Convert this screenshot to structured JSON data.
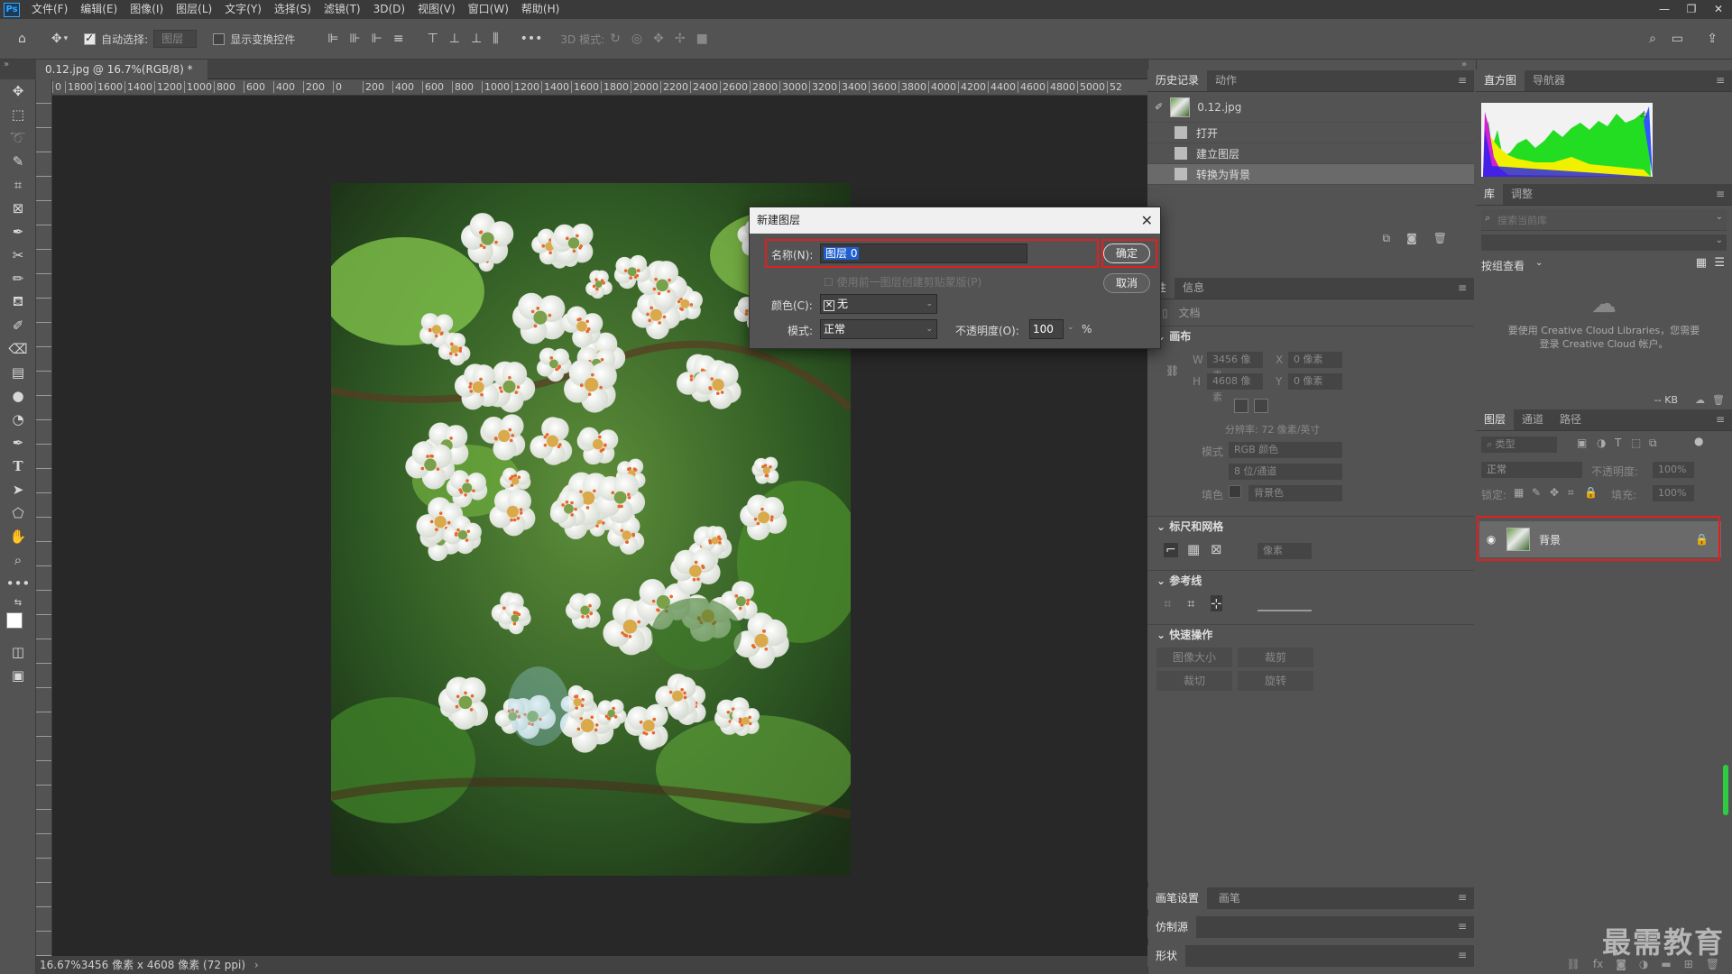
{
  "app": {
    "logo": "Ps"
  },
  "menu": [
    "文件(F)",
    "编辑(E)",
    "图像(I)",
    "图层(L)",
    "文字(Y)",
    "选择(S)",
    "滤镜(T)",
    "3D(D)",
    "视图(V)",
    "窗口(W)",
    "帮助(H)"
  ],
  "window_controls": [
    "—",
    "❐",
    "✕"
  ],
  "options_bar": {
    "auto_select_label": "自动选择:",
    "auto_select_target": "图层",
    "show_transform_label": "显示变换控件",
    "mode_3d_label": "3D 模式:",
    "more": "•••"
  },
  "document": {
    "tab_title": "0.12.jpg @ 16.7%(RGB/8) *",
    "tab_close": "×",
    "status": "16.67%3456 像素 x 4608 像素 (72 ppi)",
    "ruler_labels": [
      "0",
      "1800",
      "1600",
      "1400",
      "1200",
      "1000",
      "800",
      "600",
      "400",
      "200",
      "0",
      "200",
      "400",
      "600",
      "800",
      "1000",
      "1200",
      "1400",
      "1600",
      "1800",
      "2000",
      "2200",
      "2400",
      "2600",
      "2800",
      "3000",
      "3200",
      "3400",
      "3600",
      "3800",
      "4000",
      "4200",
      "4400",
      "4600",
      "4800",
      "5000",
      "52"
    ]
  },
  "history_panel": {
    "tabs": [
      "历史记录",
      "动作"
    ],
    "snapshot": "0.12.jpg",
    "items": [
      "打开",
      "建立图层",
      "转换为背景"
    ]
  },
  "properties_panel": {
    "tabs": [
      "性",
      "信息"
    ],
    "doc_label": "文档",
    "canvas_section": "画布",
    "w_label": "W",
    "w_value": "3456 像素",
    "h_label": "H",
    "h_value": "4608 像素",
    "x_label": "X",
    "x_value": "0 像素",
    "y_label": "Y",
    "y_value": "0 像素",
    "resolution": "分辨率: 72 像素/英寸",
    "mode_label": "模式",
    "mode_value": "RGB 颜色",
    "depth_value": "8 位/通道",
    "fill_label": "填色",
    "fill_value": "背景色",
    "rulers_section": "标尺和网格",
    "units_value": "像素",
    "guides_section": "参考线",
    "quick_section": "快速操作",
    "quick_buttons": [
      "图像大小",
      "裁剪",
      "裁切",
      "旋转"
    ]
  },
  "bottom_left_panels": {
    "brush_tabs": [
      "画笔设置",
      "画笔"
    ],
    "clone": "仿制源",
    "shape": "形状"
  },
  "histogram_panel": {
    "tabs": [
      "直方图",
      "导航器"
    ]
  },
  "library_panel": {
    "tabs": [
      "库",
      "调整"
    ],
    "search_placeholder": "搜索当前库",
    "group_label": "按组查看",
    "message": "要使用 Creative Cloud Libraries，您需要登录 Creative Cloud 帐户。",
    "kb": "-- KB"
  },
  "layers_panel": {
    "tabs": [
      "图层",
      "通道",
      "路径"
    ],
    "filter_placeholder": "类型",
    "blend_mode": "正常",
    "opacity_label": "不透明度:",
    "opacity_value": "100%",
    "lock_label": "锁定:",
    "fill_label": "填充:",
    "fill_value": "100%",
    "layer_name": "背景"
  },
  "dialog": {
    "title": "新建图层",
    "name_label": "名称(N):",
    "name_value": "图层 0",
    "clip_label": "使用前一图层创建剪贴蒙版(P)",
    "color_label": "颜色(C):",
    "color_value": "无",
    "mode_label": "模式:",
    "mode_value": "正常",
    "opacity_label": "不透明度(O):",
    "opacity_value": "100",
    "percent": "%",
    "ok": "确定",
    "cancel": "取消"
  },
  "watermark": "最需教育",
  "colors": {
    "accent_red": "#e02020",
    "selection_blue": "#1f5ed0"
  }
}
